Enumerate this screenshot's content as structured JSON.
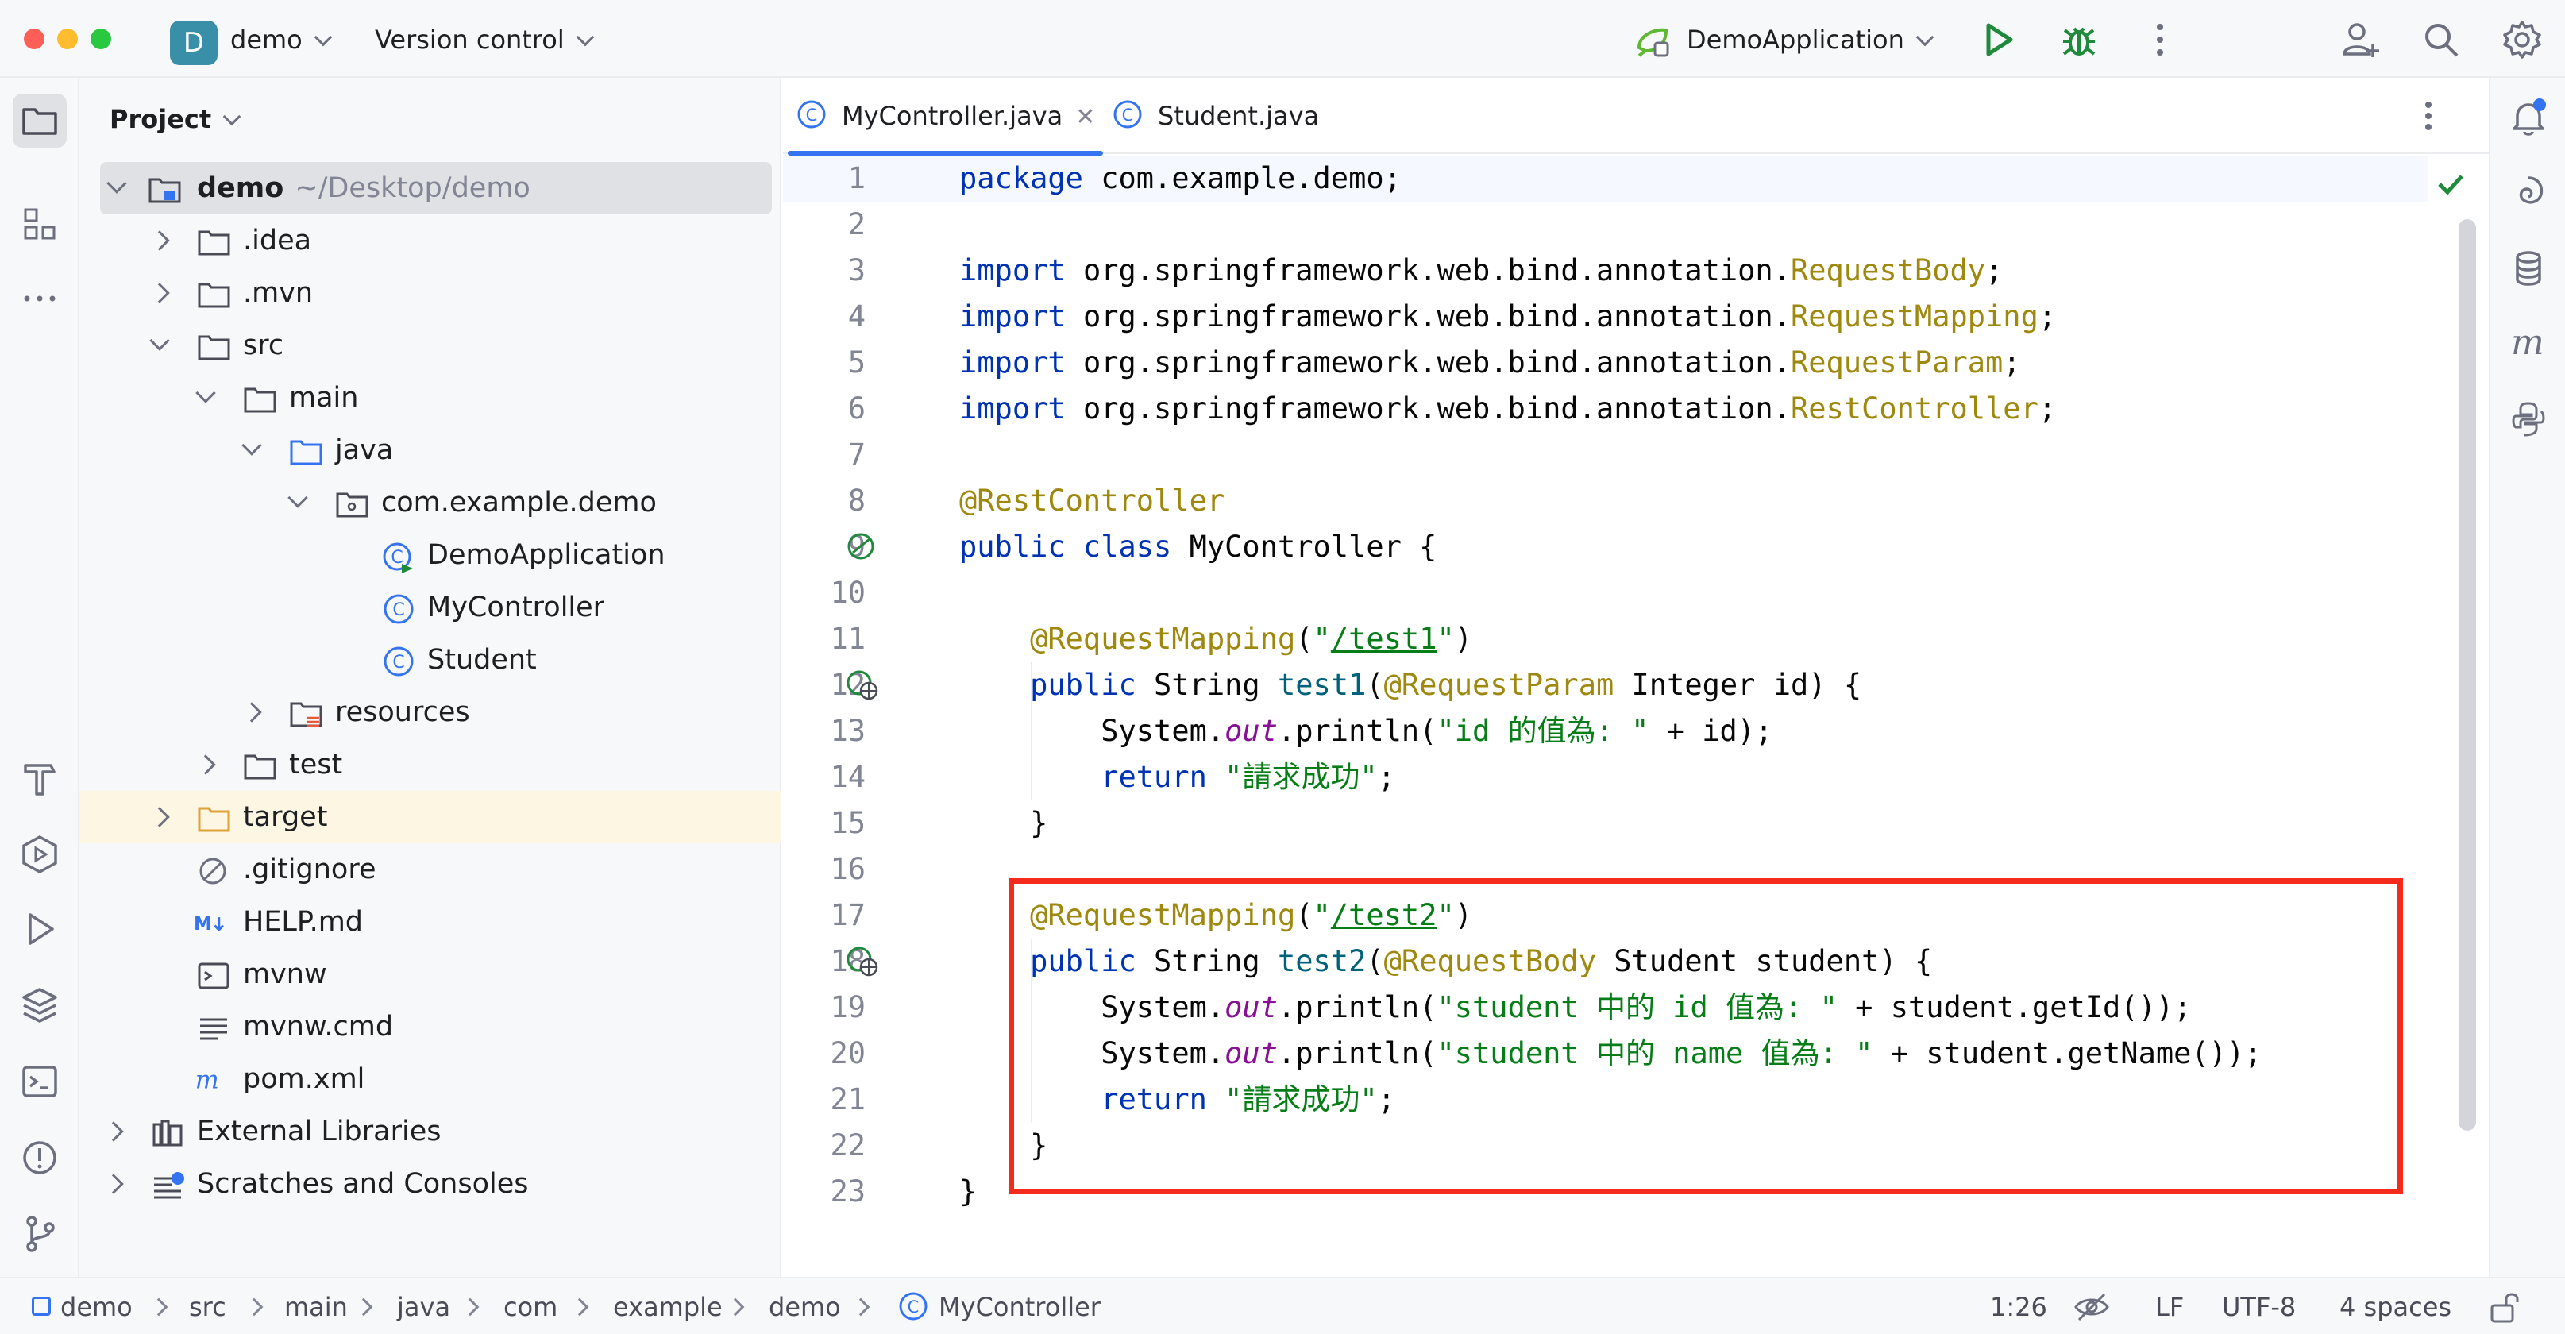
{
  "titlebar": {
    "project_badge": "D",
    "project_name": "demo",
    "vcs_label": "Version control",
    "run_config": "DemoApplication",
    "icons": [
      "run-icon",
      "debug-icon",
      "more-icon",
      "add-user-icon",
      "search-icon",
      "settings-icon"
    ]
  },
  "project_panel": {
    "header": "Project",
    "tree": [
      {
        "label": "demo",
        "sub": "~/Desktop/demo",
        "bold": true
      },
      {
        "label": ".idea"
      },
      {
        "label": ".mvn"
      },
      {
        "label": "src"
      },
      {
        "label": "main"
      },
      {
        "label": "java"
      },
      {
        "label": "com.example.demo"
      },
      {
        "label": "DemoApplication"
      },
      {
        "label": "MyController"
      },
      {
        "label": "Student"
      },
      {
        "label": "resources"
      },
      {
        "label": "test"
      },
      {
        "label": "target"
      },
      {
        "label": ".gitignore"
      },
      {
        "label": "HELP.md"
      },
      {
        "label": "mvnw"
      },
      {
        "label": "mvnw.cmd"
      },
      {
        "label": "pom.xml"
      },
      {
        "label": "External Libraries"
      },
      {
        "label": "Scratches and Consoles"
      }
    ]
  },
  "editor": {
    "tabs": [
      {
        "label": "MyController.java",
        "active": true
      },
      {
        "label": "Student.java",
        "active": false
      }
    ],
    "line_numbers": [
      "1",
      "2",
      "3",
      "4",
      "5",
      "6",
      "7",
      "8",
      "9",
      "10",
      "11",
      "12",
      "13",
      "14",
      "15",
      "16",
      "17",
      "18",
      "19",
      "20",
      "21",
      "22",
      "23"
    ],
    "code": {
      "l1a": "package",
      "l1b": " com.example.demo;",
      "l3": "org.springframework.web.bind.annotation.",
      "l3c": "RequestBody",
      "l4c": "RequestMapping",
      "l5c": "RequestParam",
      "l6c": "RestController",
      "kw_import": "import",
      "semi": ";",
      "l8": "@RestController",
      "l9a": "public class",
      "l9b": " MyController {",
      "ann_mapping": "@RequestMapping",
      "paren_open": "(",
      "quote": "\"",
      "paren_close": ")",
      "url1": "/test1",
      "url2": "/test2",
      "kw_public": "public",
      "type_string": " String ",
      "fn1": "test1",
      "fn2": "test2",
      "ann_param": "@RequestParam",
      "l12rest": " Integer id) {",
      "sys": "System.",
      "out": "out",
      "println": ".println(",
      "l13str": "\"id 的值為: \"",
      "l13rest": " + id);",
      "kw_return": "return",
      "ret_str": "\"請求成功\"",
      "close_brace": "}",
      "ann_body": "@RequestBody",
      "l18rest": " Student student) {",
      "l19str": "\"student 中的 id 值為: \"",
      "l19rest": " + student.getId());",
      "l20str": "\"student 中的 name 值為: \"",
      "l20rest": " + student.getName());"
    }
  },
  "statusbar": {
    "breadcrumbs": [
      "demo",
      "src",
      "main",
      "java",
      "com",
      "example",
      "demo",
      "MyController"
    ],
    "position": "1:26",
    "line_ending": "LF",
    "encoding": "UTF-8",
    "indent": "4 spaces"
  },
  "colors": {
    "keyword": "#0033b3",
    "annotation": "#9e880d",
    "string": "#067d17",
    "function": "#00627a",
    "static_field": "#871094",
    "highlight_box": "#f42a1c",
    "accent": "#3574f0"
  }
}
